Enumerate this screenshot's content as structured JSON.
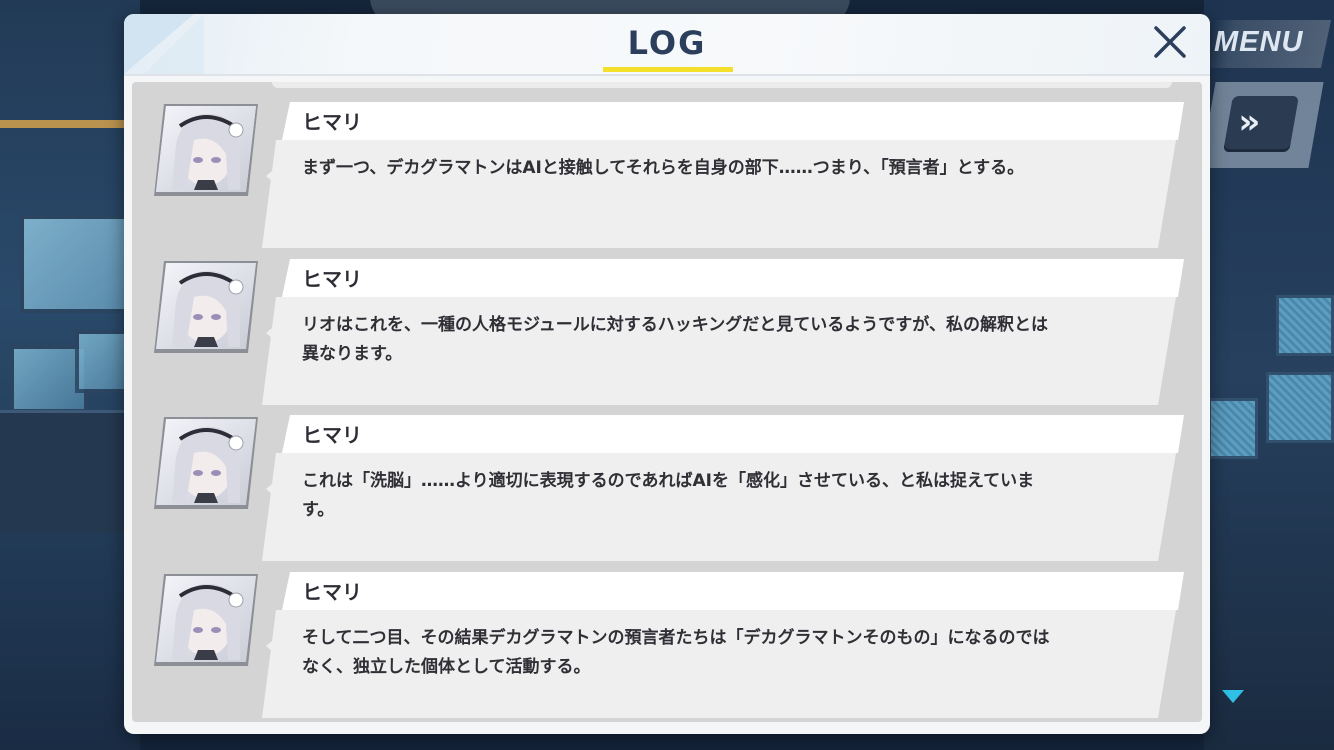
{
  "window": {
    "title": "LOG",
    "accent_color": "#f4e02c",
    "close_icon": "close-icon"
  },
  "hud": {
    "menu_label": "MENU",
    "skip_icon": "fast-forward-icon",
    "scroll_icon": "scroll-down-icon"
  },
  "entries": [
    {
      "speaker": "ヒマリ",
      "text": "まず一つ、デカグラマトンはAIと接触してそれらを自身の部下……つまり、「預言者」とする。"
    },
    {
      "speaker": "ヒマリ",
      "text": "リオはこれを、一種の人格モジュールに対するハッキングだと見ているようですが、私の解釈とは異なります。"
    },
    {
      "speaker": "ヒマリ",
      "text": "これは「洗脳」……より適切に表現するのであればAIを「感化」させている、と私は捉えています。"
    },
    {
      "speaker": "ヒマリ",
      "text": "そして二つ目、その結果デカグラマトンの預言者たちは「デカグラマトンそのもの」になるのではなく、独立した個体として活動する。"
    }
  ]
}
